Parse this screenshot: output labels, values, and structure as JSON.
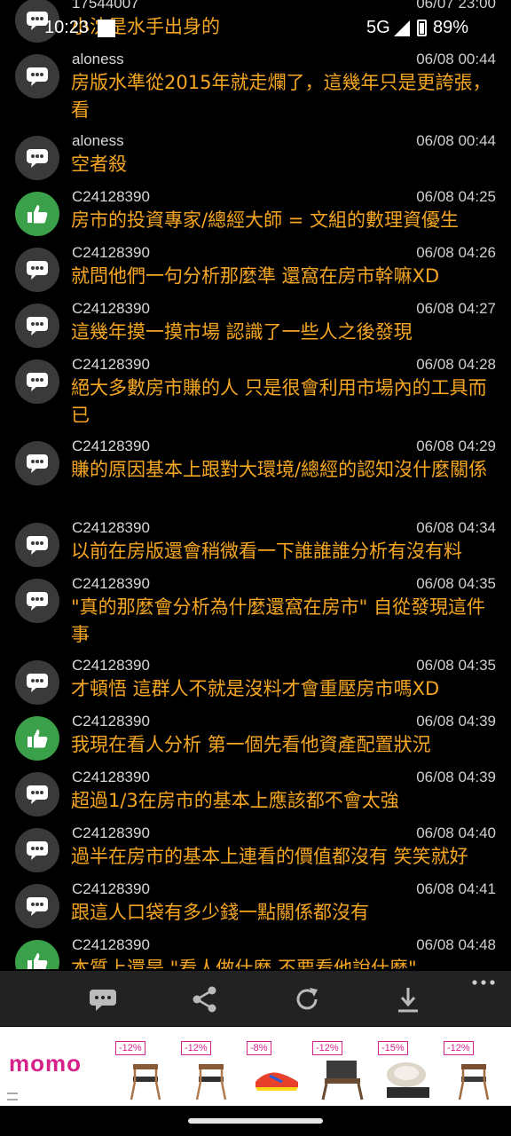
{
  "status": {
    "time": "10:23",
    "network": "5G",
    "battery": "89%"
  },
  "top_partial": {
    "user": "17544007",
    "time": "06/07 23:00",
    "text": "小沈是水手出身的"
  },
  "comments": [
    {
      "user": "aloness",
      "time": "06/08 00:44",
      "text": "房版水準從2015年就走爛了，這幾年只是更誇張，看",
      "icon": "comment-icon"
    },
    {
      "user": "aloness",
      "time": "06/08 00:44",
      "text": "空者殺",
      "icon": "comment-icon"
    },
    {
      "user": "C24128390",
      "time": "06/08 04:25",
      "text": "房市的投資專家/總經大師 = 文組的數理資優生",
      "icon": "thumbs-up-icon"
    },
    {
      "user": "C24128390",
      "time": "06/08 04:26",
      "text": "就問他們一句分析那麼準 還窩在房市幹嘛XD",
      "icon": "comment-icon"
    },
    {
      "user": "C24128390",
      "time": "06/08 04:27",
      "text": "這幾年摸一摸市場 認識了一些人之後發現",
      "icon": "comment-icon"
    },
    {
      "user": "C24128390",
      "time": "06/08 04:28",
      "text": "絕大多數房市賺的人 只是很會利用市場內的工具而已",
      "icon": "comment-icon"
    },
    {
      "user": "C24128390",
      "time": "06/08 04:29",
      "text": "賺的原因基本上跟對大環境/總經的認知沒什麼關係",
      "icon": "comment-icon"
    },
    {
      "user": "C24128390",
      "time": "06/08 04:34",
      "text": "以前在房版還會稍微看一下誰誰誰分析有沒有料",
      "icon": "comment-icon"
    },
    {
      "user": "C24128390",
      "time": "06/08 04:35",
      "text": "\"真的那麼會分析為什麼還窩在房市\" 自從發現這件事",
      "icon": "comment-icon"
    },
    {
      "user": "C24128390",
      "time": "06/08 04:35",
      "text": "才頓悟 這群人不就是沒料才會重壓房市嗎XD",
      "icon": "comment-icon"
    },
    {
      "user": "C24128390",
      "time": "06/08 04:39",
      "text": "我現在看人分析 第一個先看他資產配置狀況",
      "icon": "thumbs-up-icon"
    },
    {
      "user": "C24128390",
      "time": "06/08 04:39",
      "text": "超過1/3在房市的基本上應該都不會太強",
      "icon": "comment-icon"
    },
    {
      "user": "C24128390",
      "time": "06/08 04:40",
      "text": "過半在房市的基本上連看的價值都沒有 笑笑就好",
      "icon": "comment-icon"
    },
    {
      "user": "C24128390",
      "time": "06/08 04:41",
      "text": "跟這人口袋有多少錢一點關係都沒有",
      "icon": "comment-icon"
    },
    {
      "user": "C24128390",
      "time": "06/08 04:48",
      "text": "本質上還是 \"看人做什麼 不要看他說什麼\"",
      "icon": "thumbs-up-icon"
    }
  ],
  "toolbar": {
    "buttons": [
      "comment-icon",
      "share-icon",
      "refresh-icon",
      "download-icon",
      "more-icon"
    ]
  },
  "ad": {
    "brand": "momo",
    "items": [
      {
        "discount": "-12%",
        "product": "chair-icon"
      },
      {
        "discount": "-12%",
        "product": "chair-icon"
      },
      {
        "discount": "-8%",
        "product": "shoe-icon"
      },
      {
        "discount": "-12%",
        "product": "armchair-icon"
      },
      {
        "discount": "-15%",
        "product": "cookware-icon"
      },
      {
        "discount": "-12%",
        "product": "chair-icon"
      }
    ]
  },
  "colors": {
    "comment_text": "#f5a623",
    "push_avatar": "#3aa04a",
    "neutral_avatar": "#3a3a3a",
    "brand": "#d6218a"
  }
}
